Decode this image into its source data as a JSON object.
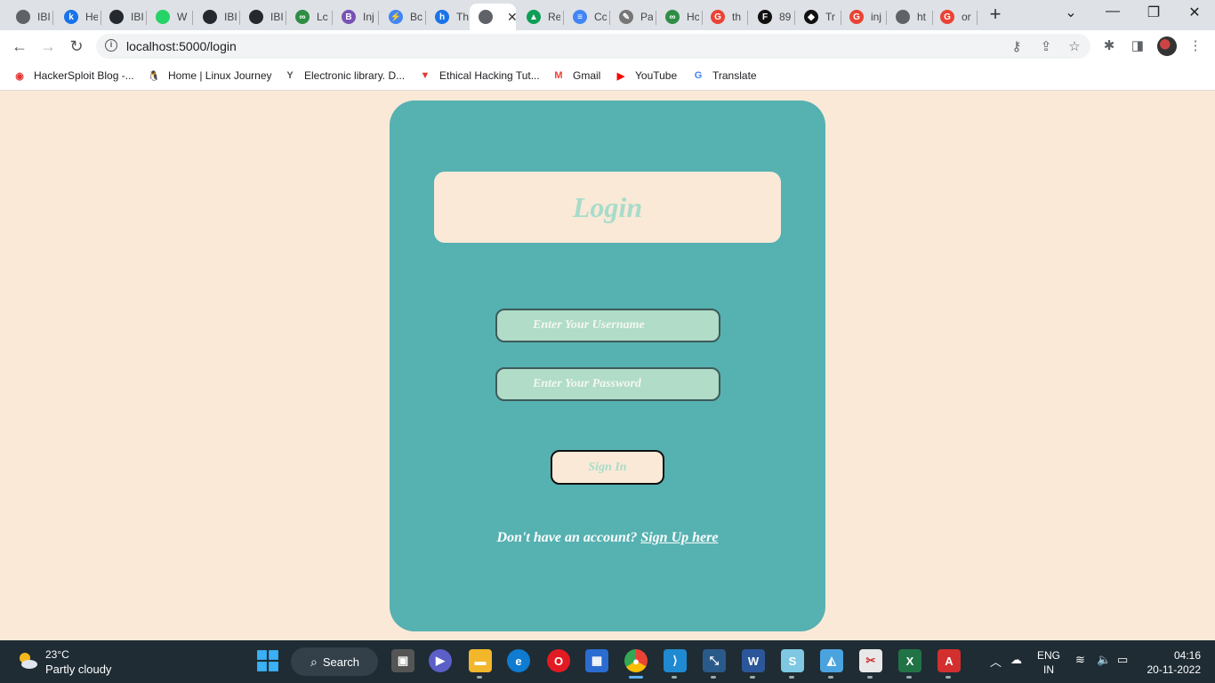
{
  "browser": {
    "tabs": [
      {
        "title": "IBI",
        "color": "#5f6368",
        "glyph": ""
      },
      {
        "title": "He",
        "color": "#1a73e8",
        "glyph": "k"
      },
      {
        "title": "IBI",
        "color": "#24292f",
        "glyph": ""
      },
      {
        "title": "W",
        "color": "#25d366",
        "glyph": ""
      },
      {
        "title": "IBI",
        "color": "#24292f",
        "glyph": ""
      },
      {
        "title": "IBI",
        "color": "#24292f",
        "glyph": ""
      },
      {
        "title": "Lc",
        "color": "#2f8d46",
        "glyph": "∞"
      },
      {
        "title": "Inj",
        "color": "#7952b3",
        "glyph": "B"
      },
      {
        "title": "Bc",
        "color": "#4285f4",
        "glyph": "⚡"
      },
      {
        "title": "Th",
        "color": "#1a73e8",
        "glyph": "h"
      },
      {
        "title": "",
        "color": "#5f6368",
        "glyph": ""
      },
      {
        "title": "Re",
        "color": "#0f9d58",
        "glyph": "▲"
      },
      {
        "title": "Cc",
        "color": "#4285f4",
        "glyph": "≡"
      },
      {
        "title": "Pa",
        "color": "#777777",
        "glyph": "✎"
      },
      {
        "title": "Hc",
        "color": "#2f8d46",
        "glyph": "∞"
      },
      {
        "title": "th",
        "color": "#ea4335",
        "glyph": "G"
      },
      {
        "title": "89",
        "color": "#111111",
        "glyph": "F"
      },
      {
        "title": "Tr",
        "color": "#111111",
        "glyph": "◆"
      },
      {
        "title": "inj",
        "color": "#ea4335",
        "glyph": "G"
      },
      {
        "title": "ht",
        "color": "#5f6368",
        "glyph": ""
      },
      {
        "title": "or",
        "color": "#ea4335",
        "glyph": "G"
      }
    ],
    "active_close": "✕",
    "new_tab": "+",
    "window_controls": {
      "tabsearch": "⌄",
      "minimize": "—",
      "restore": "❐",
      "close": "✕"
    },
    "url": "localhost:5000/login",
    "bookmarks": [
      {
        "label": "HackerSploit Blog -...",
        "icon": "shield-icon",
        "color": "#e53935",
        "glyph": "◉"
      },
      {
        "label": "Home | Linux Journey",
        "icon": "penguin-icon",
        "color": "#222222",
        "glyph": "🐧"
      },
      {
        "label": "Electronic library. D...",
        "icon": "library-icon",
        "color": "#555555",
        "glyph": "Y"
      },
      {
        "label": "Ethical Hacking Tut...",
        "icon": "hacking-icon",
        "color": "#e53935",
        "glyph": "▼"
      },
      {
        "label": "Gmail",
        "icon": "gmail-icon",
        "color": "#ea4335",
        "glyph": "M"
      },
      {
        "label": "YouTube",
        "icon": "youtube-icon",
        "color": "#ff0000",
        "glyph": "▶"
      },
      {
        "label": "Translate",
        "icon": "translate-icon",
        "color": "#4285f4",
        "glyph": "G"
      }
    ]
  },
  "login": {
    "title": "Login",
    "username_placeholder": "Enter Your Username",
    "password_placeholder": "Enter Your Password",
    "submit_label": "Sign In",
    "signup_prompt": "Don't have an account?",
    "signup_link": "Sign Up here"
  },
  "taskbar": {
    "temperature": "23°C",
    "weather": "Partly cloudy",
    "search_label": "Search",
    "language": "ENG",
    "region": "IN",
    "time": "04:16",
    "date": "20-11-2022"
  }
}
